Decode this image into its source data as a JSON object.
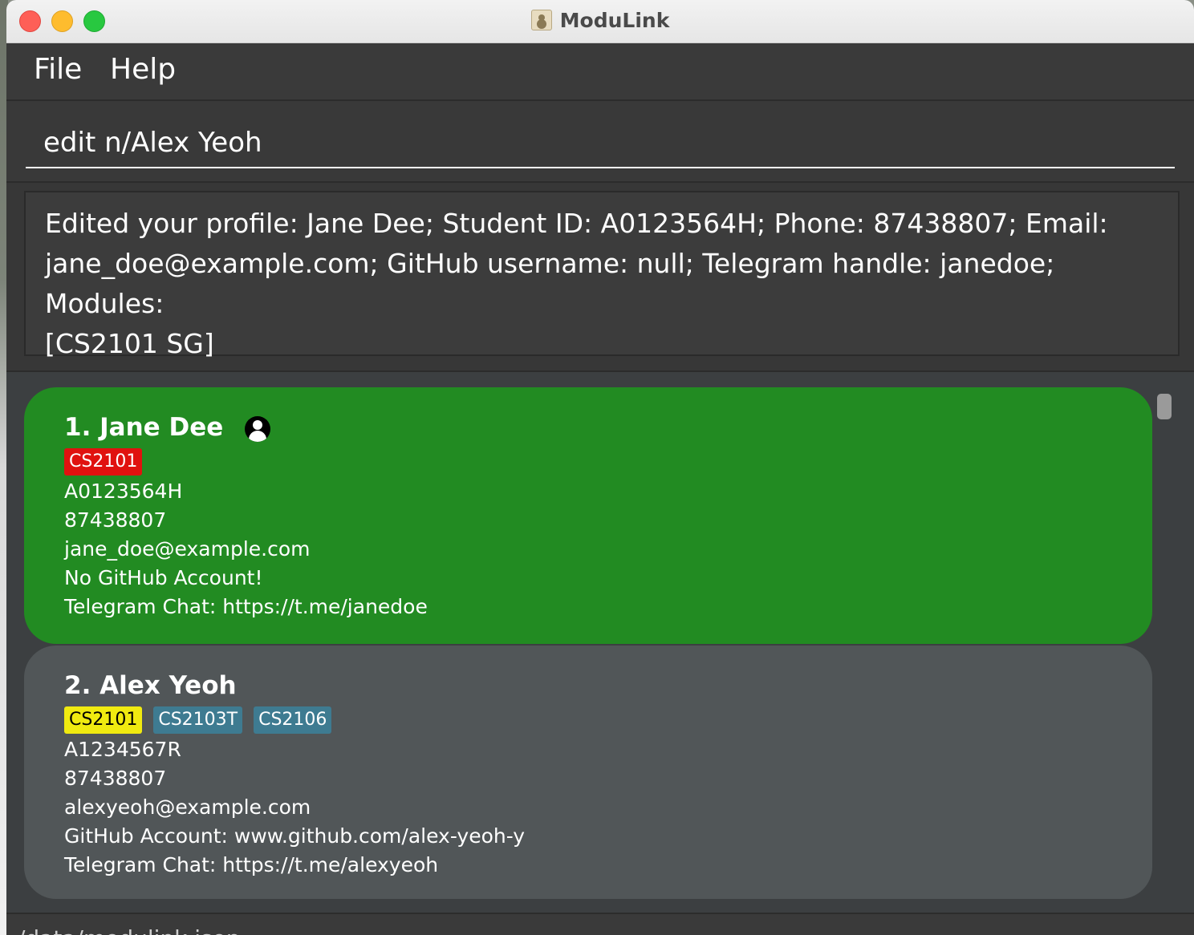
{
  "window": {
    "title": "ModuLink"
  },
  "menu": {
    "file": "File",
    "help": "Help"
  },
  "command": {
    "value": "edit n/Alex Yeoh"
  },
  "result": {
    "lines": [
      "Edited your profile: Jane Dee; Student ID: A0123564H; Phone: 87438807; Email:",
      "jane_doe@example.com; GitHub username: null; Telegram handle: janedoe; Modules:",
      "[CS2101 SG]"
    ]
  },
  "persons": [
    {
      "name": "1. Jane Dee",
      "tags": [
        "CS2101"
      ],
      "student_id": "A0123564H",
      "phone": "87438807",
      "email": "jane_doe@example.com",
      "github": "No GitHub Account!",
      "telegram": "Telegram Chat: https://t.me/janedoe"
    },
    {
      "name": "2. Alex Yeoh",
      "tags": [
        "CS2101",
        "CS2103T",
        "CS2106"
      ],
      "student_id": "A1234567R",
      "phone": "87438807",
      "email": "alexyeoh@example.com",
      "github": "GitHub Account: www.github.com/alex-yeoh-y",
      "telegram": "Telegram Chat: https://t.me/alexyeoh"
    }
  ],
  "status": {
    "path": "/data/modulink.json"
  },
  "colors": {
    "selected_card": "#228b22",
    "card": "#515658",
    "tag_red": "#e0120f",
    "tag_yellow": "#f0ea10",
    "tag_blue": "#3e7b91"
  }
}
